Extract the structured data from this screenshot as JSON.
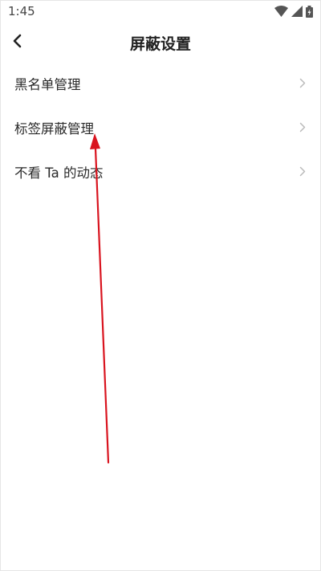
{
  "status_bar": {
    "time": "1:45",
    "icons": [
      "wifi-icon",
      "signal-icon",
      "battery-icon"
    ]
  },
  "header": {
    "back_icon": "chevron-left-icon",
    "title": "屏蔽设置"
  },
  "menu": {
    "items": [
      {
        "label": "黑名单管理",
        "icon": "chevron-right-icon"
      },
      {
        "label": "标签屏蔽管理",
        "icon": "chevron-right-icon"
      },
      {
        "label": "不看 Ta 的动态",
        "icon": "chevron-right-icon"
      }
    ]
  },
  "annotation": {
    "type": "arrow",
    "color": "#d9141f",
    "points_to": "标签屏蔽管理"
  },
  "colors": {
    "background": "#ffffff",
    "text": "#222222",
    "chevron": "#bbbbbb",
    "annotation_arrow": "#d9141f"
  }
}
